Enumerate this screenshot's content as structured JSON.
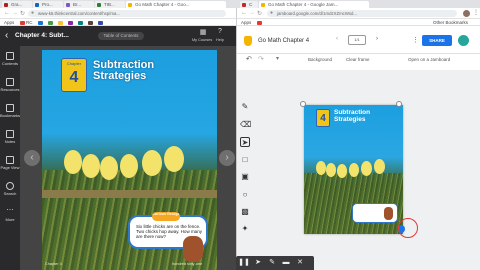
{
  "browser": {
    "tabs": [
      {
        "label": "Gra..."
      },
      {
        "label": "Pro..."
      },
      {
        "label": "Br..."
      },
      {
        "label": "TIB..."
      },
      {
        "label": "Go Math Chapter 4 - Goo..."
      },
      {
        "label": "C"
      },
      {
        "label": "Go Math Chapter 4 - Google Jam..."
      }
    ],
    "left_url": "www-k6.thinkcentral.com/content/hsp/ma...",
    "right_url": "jamboard.google.com/d/1mdzXZmcWsd...",
    "bookmarks_left": [
      "Apps",
      "RC",
      "",
      "",
      "",
      "",
      "",
      ""
    ],
    "bookmarks_right": [
      "Apps",
      "",
      "Other Bookmarks"
    ]
  },
  "reader": {
    "title": "Chapter 4: Subt...",
    "page_label": "Table of Contents",
    "my_courses": "My Courses",
    "help": "Help",
    "rail": [
      {
        "label": "Contents"
      },
      {
        "label": "Resources"
      },
      {
        "label": "Bookmarks"
      },
      {
        "label": "Notes"
      },
      {
        "label": "Page View"
      },
      {
        "label": "Search"
      },
      {
        "label": "More"
      }
    ],
    "book_chapter_label": "Chapter",
    "book_chapter_number": "4",
    "book_title_line1": "Subtraction",
    "book_title_line2": "Strategies",
    "callout_tag": "Curious George",
    "callout_text": "Six little chicks are on the fence. Two chicks hop away. How many are there now?",
    "footer_left": "Chapter 4",
    "footer_right": "hundred sixty-one"
  },
  "jamboard": {
    "doc_title": "Go Math Chapter 4",
    "frame_counter": "1/1",
    "share_label": "SHARE",
    "undo_icon": "undo-icon",
    "redo_icon": "redo-icon",
    "zoom_icon": "zoom-icon",
    "background_label": "Background",
    "clear_label": "Clear frame",
    "open_label": "Open on a Jamboard",
    "frame_chapter_number": "4",
    "frame_title_line1": "Subtraction",
    "frame_title_line2": "Strategies",
    "colors": {
      "share": "#1a73e8",
      "accent_ring": "#e53935"
    }
  }
}
